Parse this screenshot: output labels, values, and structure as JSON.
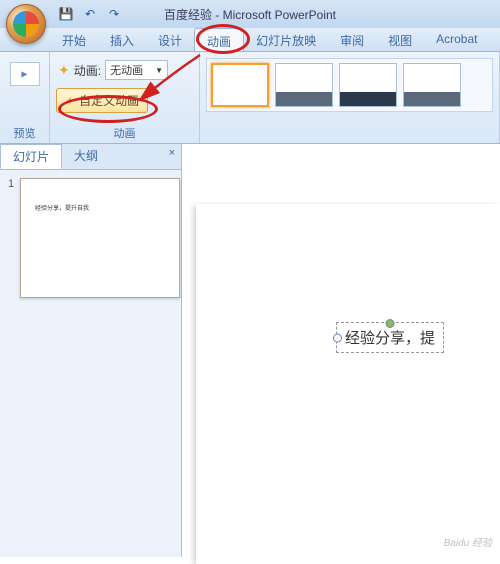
{
  "title": "百度经验 - Microsoft PowerPoint",
  "qat": {
    "save": "💾",
    "undo": "↶",
    "redo": "↷"
  },
  "menu": {
    "items": [
      "开始",
      "插入",
      "设计",
      "动画",
      "幻灯片放映",
      "审阅",
      "视图",
      "Acrobat"
    ],
    "active_index": 3
  },
  "ribbon": {
    "preview_label": "预览",
    "anim_label": "动画:",
    "anim_value": "无动画",
    "custom_anim": "自定义动画",
    "anim_group_label": "动画"
  },
  "sidebar": {
    "tabs": [
      "幻灯片",
      "大纲"
    ],
    "close": "×",
    "slide_num": "1",
    "thumb_text": "经验分享，提升自我"
  },
  "textbox": "经验分享，提",
  "watermark": "Baidu 经验"
}
